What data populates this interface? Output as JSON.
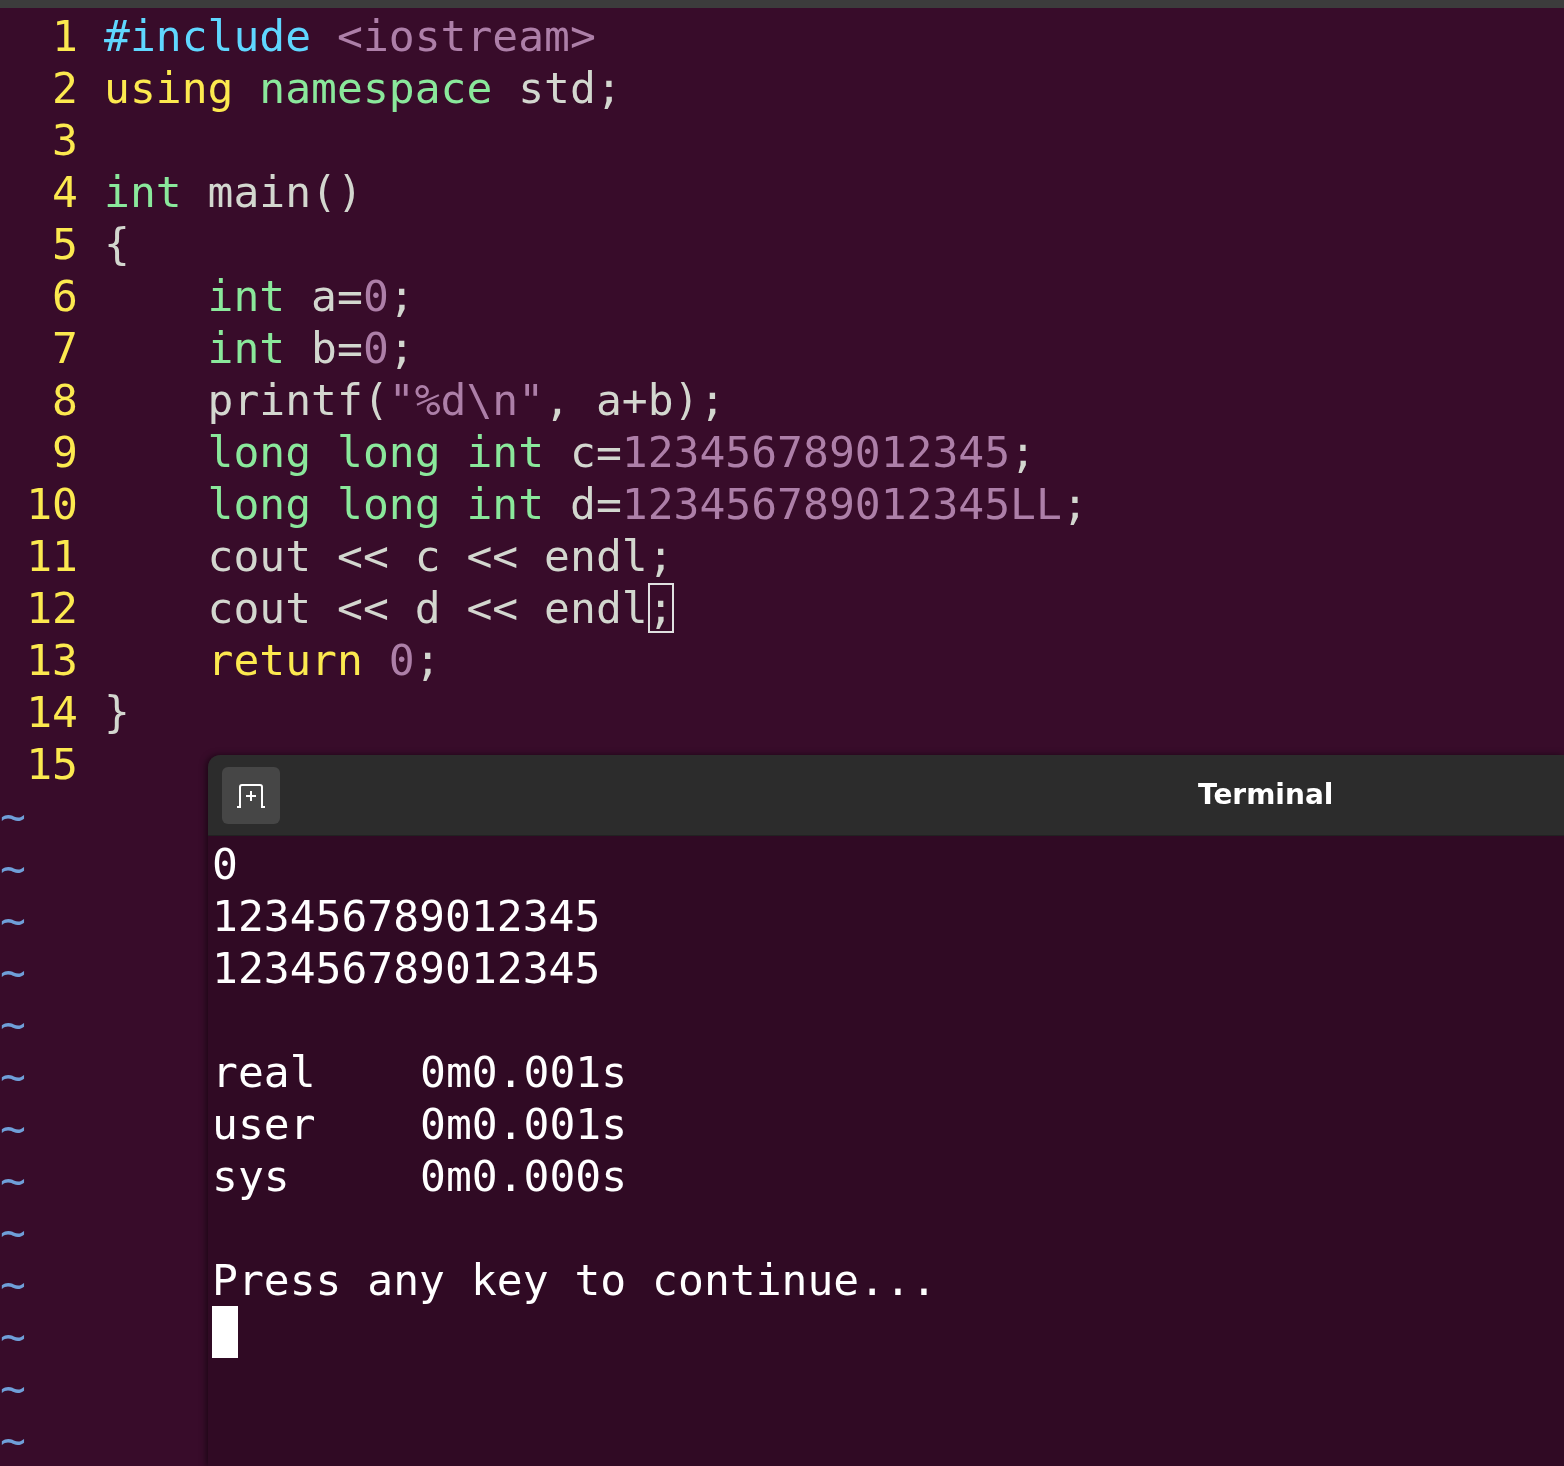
{
  "editor": {
    "lines": [
      {
        "number": "1",
        "tokens": [
          {
            "text": "#include",
            "kind": "preproc"
          },
          {
            "text": " <iostream>",
            "kind": "constant"
          }
        ]
      },
      {
        "number": "2",
        "tokens": [
          {
            "text": "using",
            "kind": "statement"
          },
          {
            "text": " namespace",
            "kind": "type"
          },
          {
            "text": " std;",
            "kind": "plain"
          }
        ]
      },
      {
        "number": "3"
      },
      {
        "number": "4",
        "tokens": [
          {
            "text": "int",
            "kind": "type"
          },
          {
            "text": " main()",
            "kind": "plain"
          }
        ]
      },
      {
        "number": "5",
        "tokens": [
          {
            "text": "{",
            "kind": "plain"
          }
        ]
      },
      {
        "number": "6",
        "tokens": [
          {
            "text": "    int",
            "kind": "type"
          },
          {
            "text": " a=",
            "kind": "plain"
          },
          {
            "text": "0",
            "kind": "constant"
          },
          {
            "text": ";",
            "kind": "plain"
          }
        ]
      },
      {
        "number": "7",
        "tokens": [
          {
            "text": "    int",
            "kind": "type"
          },
          {
            "text": " b=",
            "kind": "plain"
          },
          {
            "text": "0",
            "kind": "constant"
          },
          {
            "text": ";",
            "kind": "plain"
          }
        ]
      },
      {
        "number": "8",
        "tokens": [
          {
            "text": "    printf(",
            "kind": "plain"
          },
          {
            "text": "\"%d\\n\"",
            "kind": "constant"
          },
          {
            "text": ", a+b);",
            "kind": "plain"
          }
        ]
      },
      {
        "number": "9",
        "tokens": [
          {
            "text": "    long long int",
            "kind": "type"
          },
          {
            "text": " c=",
            "kind": "plain"
          },
          {
            "text": "123456789012345",
            "kind": "constant"
          },
          {
            "text": ";",
            "kind": "plain"
          }
        ]
      },
      {
        "number": "10",
        "tokens": [
          {
            "text": "    long long int",
            "kind": "type"
          },
          {
            "text": " d=",
            "kind": "plain"
          },
          {
            "text": "123456789012345LL",
            "kind": "constant"
          },
          {
            "text": ";",
            "kind": "plain"
          }
        ]
      },
      {
        "number": "11",
        "tokens": [
          {
            "text": "    cout << c << endl;",
            "kind": "plain"
          }
        ]
      },
      {
        "number": "12",
        "tokens": [
          {
            "text": "    cout << d << endl",
            "kind": "plain"
          },
          {
            "text": ";",
            "kind": "cursor"
          }
        ]
      },
      {
        "number": "13",
        "tokens": [
          {
            "text": "    return",
            "kind": "statement"
          },
          {
            "text": " 0",
            "kind": "constant"
          },
          {
            "text": ";",
            "kind": "plain"
          }
        ]
      },
      {
        "number": "14",
        "tokens": [
          {
            "text": "}",
            "kind": "plain"
          }
        ]
      },
      {
        "number": "15"
      }
    ],
    "tildes": [
      "~",
      "~",
      "~",
      "~",
      "~",
      "~",
      "~",
      "~",
      "~",
      "~",
      "~",
      "~",
      "~"
    ]
  },
  "terminal": {
    "title": "Terminal",
    "cursor_visible": true,
    "output": [
      {
        "kind": "text",
        "text": "0"
      },
      {
        "kind": "text",
        "text": "123456789012345"
      },
      {
        "kind": "text",
        "text": "123456789012345"
      },
      {
        "kind": "blank"
      },
      {
        "kind": "timing",
        "label": "real",
        "value": "0m0.001s"
      },
      {
        "kind": "timing",
        "label": "user",
        "value": "0m0.001s"
      },
      {
        "kind": "timing",
        "label": "sys",
        "value": "0m0.000s"
      },
      {
        "kind": "blank"
      },
      {
        "kind": "text",
        "text": "Press any key to continue..."
      }
    ]
  }
}
